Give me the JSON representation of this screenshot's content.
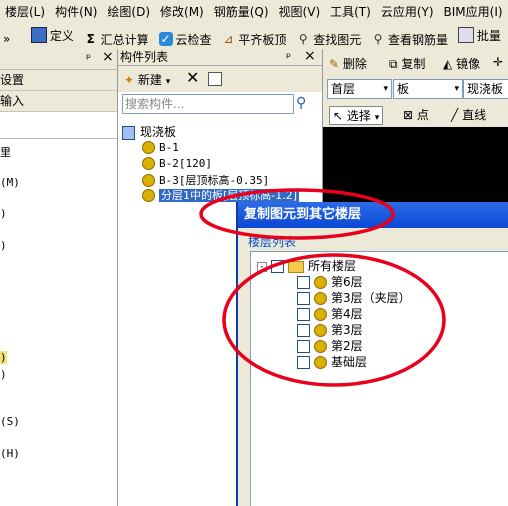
{
  "menubar": [
    "楼层(L)",
    "构件(N)",
    "绘图(D)",
    "修改(M)",
    "钢筋量(Q)",
    "视图(V)",
    "工具(T)",
    "云应用(Y)",
    "BIM应用(I)"
  ],
  "toolbar": {
    "overflow": "»",
    "items": [
      {
        "label": "定义",
        "icon": "define-icon"
      },
      {
        "label": "汇总计算",
        "icon": "sigma-icon",
        "glyph": "Σ"
      },
      {
        "label": "云检查",
        "icon": "cloud-check-icon"
      },
      {
        "label": "平齐板顶",
        "icon": "align-slab-icon"
      },
      {
        "label": "查找图元",
        "icon": "find-element-icon"
      },
      {
        "label": "查看钢筋量",
        "icon": "view-rebar-icon"
      },
      {
        "label": "批量",
        "icon": "batch-icon"
      }
    ]
  },
  "left_panel": {
    "pin": "ᵖ",
    "close": "×",
    "row1": "设置",
    "row2": "输入",
    "items": [
      "里",
      "(M)",
      ")",
      ")",
      ")",
      ")",
      "(S)",
      "(H)"
    ]
  },
  "component_list": {
    "title": "构件列表",
    "pin": "ᵖ",
    "close": "×",
    "new_label": "新建",
    "search_placeholder": "搜索构件...",
    "root": "现浇板",
    "items": [
      "B-1",
      "B-2[120]",
      "B-3[层顶标高-0.35]",
      "分层1中的板[层顶标高-1.2]"
    ]
  },
  "right_area": {
    "delete_label": "删除",
    "copy_label": "复制",
    "mirror_label": "镜像",
    "floor_combo": "首层",
    "type_combo": "板",
    "sub_combo": "现浇板",
    "select_label": "选择",
    "point_label": "点",
    "line_label": "直线"
  },
  "dialog": {
    "title": "复制图元到其它楼层",
    "group_label": "楼层列表",
    "root": "所有楼层",
    "floors": [
      "第6层",
      "第3层（夹层）",
      "第4层",
      "第3层",
      "第2层",
      "基础层"
    ]
  },
  "colors": {
    "annotation": "#e8001c",
    "dialog_title": "#0b48d4",
    "selection": "#316ac5"
  }
}
